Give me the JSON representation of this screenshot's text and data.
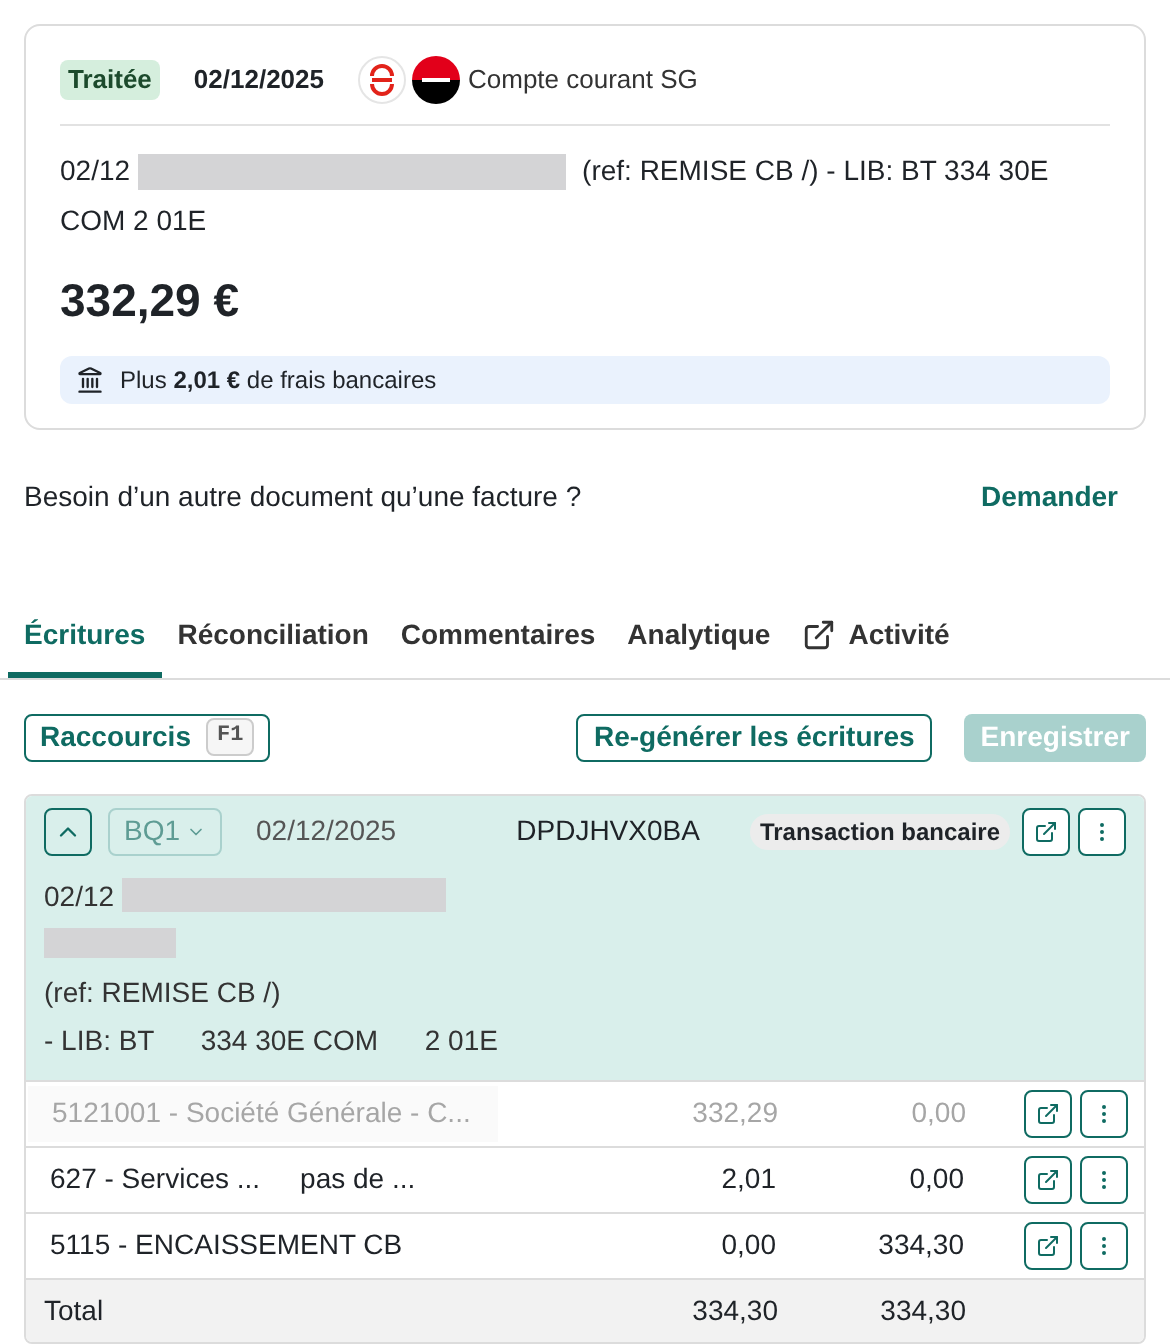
{
  "transaction": {
    "status": "Traitée",
    "date": "02/12/2025",
    "account": "Compte courant SG",
    "label_start": "02/12",
    "label_rest": "(ref: REMISE CB /) - LIB: BT 334 30E",
    "label_end": "COM 2 01E",
    "amount": "332,29 €",
    "fees_note": "Plus **2,01 €** de frais bancaires"
  },
  "request": {
    "question": "Besoin d’un autre document qu’une facture ?",
    "link": "Demander"
  },
  "tabs": [
    {
      "label": "Écritures",
      "selected": true,
      "kind": "plain"
    },
    {
      "label": "Réconciliation",
      "selected": false,
      "kind": "plain"
    },
    {
      "label": "Commentaires",
      "selected": false,
      "kind": "plain"
    },
    {
      "label": "Analytique",
      "selected": false,
      "kind": "plain"
    },
    {
      "label": "Activité",
      "selected": false,
      "kind": "external"
    }
  ],
  "toolbar": {
    "shortcuts": "Raccourcis",
    "shortcut_key": "F1",
    "regenerate": "Re-générer les écritures",
    "save": "Enregistrer",
    "save_disabled": true
  },
  "entry": {
    "expanded": true,
    "journal": "BQ1",
    "date": "02/12/2025",
    "reference": "DPDJHVX0BA",
    "type": "Transaction bancaire",
    "description_lines": [
      "02/12",
      "(ref: REMISE CB /)",
      "- LIB: BT      334 30E COM      2 01E"
    ],
    "lines": [
      {
        "account": "5121001 - Société Générale - C...",
        "debit": "332,29",
        "credit": "0,00",
        "disabled": true
      },
      {
        "account": "627 - Services ...",
        "label": "pas de ...",
        "debit": "2,01",
        "credit": "0,00",
        "disabled": false
      },
      {
        "account": "5115 - ENCAISSEMENT CB",
        "debit": "0,00",
        "credit": "334,30",
        "disabled": false
      }
    ],
    "total": {
      "label": "Total",
      "debit": "334,30",
      "credit": "334,30"
    }
  }
}
